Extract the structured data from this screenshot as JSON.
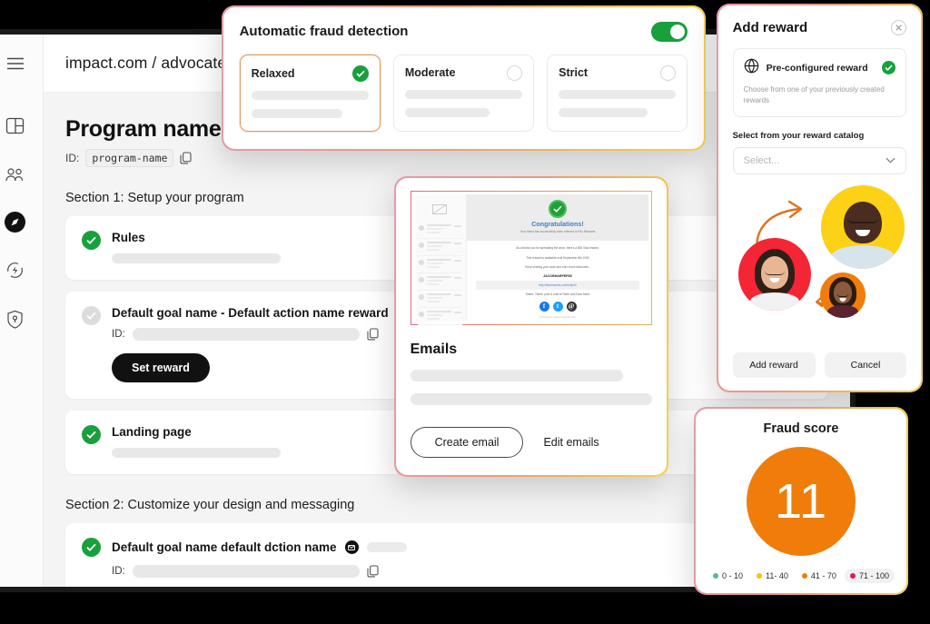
{
  "sidebar": {
    "items": [
      {
        "name": "menu-hamburger",
        "icon": "hamburger-icon"
      },
      {
        "name": "dashboard",
        "icon": "layout-dashboard-icon"
      },
      {
        "name": "audiences",
        "icon": "people-group-icon"
      },
      {
        "name": "programs",
        "icon": "compass-icon",
        "active": true
      },
      {
        "name": "payouts",
        "icon": "lightning-refresh-icon"
      },
      {
        "name": "fraud-protection",
        "icon": "shield-lock-icon"
      }
    ]
  },
  "topbar": {
    "brand": "impact.com / advocate"
  },
  "page": {
    "title": "Program name",
    "id_label": "ID:",
    "id_value": "program-name",
    "copy_icon": "copy-icon",
    "section1_title": "Section 1: Setup your program",
    "section2_title": "Section 2: Customize your design and messaging",
    "rows": [
      {
        "title": "Rules",
        "checked": true
      },
      {
        "title": "Default goal name - Default action name reward",
        "checked": false,
        "id_label": "ID:",
        "button": "Set reward"
      },
      {
        "title": "Landing page",
        "checked": true
      }
    ],
    "section2_rows": [
      {
        "title": "Default goal name default dction name",
        "checked": true,
        "id_label": "ID:",
        "email_icon": "envelope-icon",
        "toggle_on": true
      }
    ]
  },
  "fraud_detection": {
    "title": "Automatic fraud detection",
    "toggle_on": true,
    "toggle_color": "#17a03c",
    "options": [
      {
        "label": "Relaxed",
        "selected": true
      },
      {
        "label": "Moderate",
        "selected": false
      },
      {
        "label": "Strict",
        "selected": false
      }
    ]
  },
  "emails": {
    "preview": {
      "badge_icon": "check-circle-icon",
      "headline": "Congratulations!",
      "subline": "Your friend has successfully been referred to Kilo Rewards",
      "line1": "As a thank you for spreading the word, here's a $50 Visa reward.",
      "line2": "This reward is available until September 8th 2030",
      "line3": "Keep sharing your code and earn more discounts -",
      "code": "JACOBHARPER50",
      "link": "http://kilorewards.com/m/jh40",
      "share_text": "Share, Tweet, post & mail to Refer and Earn More",
      "socials": [
        "facebook-icon",
        "twitter-icon",
        "email-icon"
      ],
      "footer": "Powered by impact.com/advocate"
    },
    "title": "Emails",
    "create_button": "Create email",
    "edit_link": "Edit emails"
  },
  "add_reward": {
    "title": "Add reward",
    "close_icon": "close-icon",
    "option": {
      "icon": "globe-icon",
      "label": "Pre-configured reward",
      "description": "Choose from one of your previously created rewards",
      "selected": true
    },
    "field_label": "Select from your reward catalog",
    "select_placeholder": "Select...",
    "chevron_icon": "chevron-down-icon",
    "avatars": [
      {
        "name": "avatar-yellow",
        "color": "#fcd116"
      },
      {
        "name": "avatar-red",
        "color": "#f42534"
      },
      {
        "name": "avatar-orange",
        "color": "#f07d0a"
      }
    ],
    "primary_button": "Add reward",
    "secondary_button": "Cancel"
  },
  "fraud_score": {
    "title": "Fraud score",
    "value": "11",
    "value_color": "#f07d0a",
    "legend": [
      {
        "label": "0 - 10",
        "color": "#5bb98c",
        "highlighted": false
      },
      {
        "label": "11- 40",
        "color": "#f2c413",
        "highlighted": false
      },
      {
        "label": "41 - 70",
        "color": "#f07d0a",
        "highlighted": false
      },
      {
        "label": "71 - 100",
        "color": "#d81b60",
        "highlighted": true
      }
    ]
  }
}
